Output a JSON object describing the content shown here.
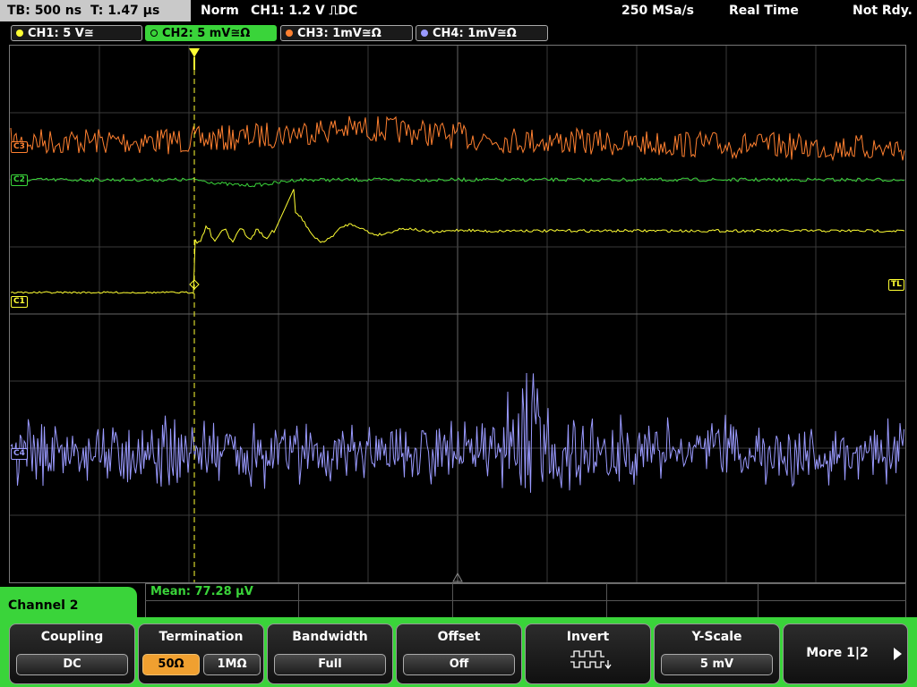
{
  "topbar": {
    "timebase": "TB: 500 ns",
    "trigger_pos": "T: 1.47 µs",
    "mode": "Norm",
    "trigger": "CH1: 1.2 V ⎍DC",
    "sample_rate": "250 MSa/s",
    "acq_mode": "Real Time",
    "state": "Not Rdy."
  },
  "channels": [
    {
      "label": "CH1: 5 V≅",
      "color": "#ffff33"
    },
    {
      "label": "CH2: 5 mV≅Ω",
      "color": "#3ad43a"
    },
    {
      "label": "CH3: 1mV≅Ω",
      "color": "#ff8030"
    },
    {
      "label": "CH4: 1mV≅Ω",
      "color": "#9a9aff"
    }
  ],
  "markers": {
    "ch1": "C1",
    "ch2": "C2",
    "ch3": "C3",
    "ch4": "C4",
    "trig_level": "TL"
  },
  "measurement": {
    "mean": "Mean: 77.28 µV"
  },
  "menu": {
    "title": "Channel 2",
    "coupling": {
      "label": "Coupling",
      "value": "DC"
    },
    "termination": {
      "label": "Termination",
      "opt1": "50Ω",
      "opt2": "1MΩ",
      "selected": "50Ω"
    },
    "bandwidth": {
      "label": "Bandwidth",
      "value": "Full"
    },
    "offset": {
      "label": "Offset",
      "value": "Off"
    },
    "invert": {
      "label": "Invert",
      "icon": "square-wave-invert-icon"
    },
    "yscale": {
      "label": "Y-Scale",
      "value": "5 mV"
    },
    "more": "More 1|2"
  }
}
